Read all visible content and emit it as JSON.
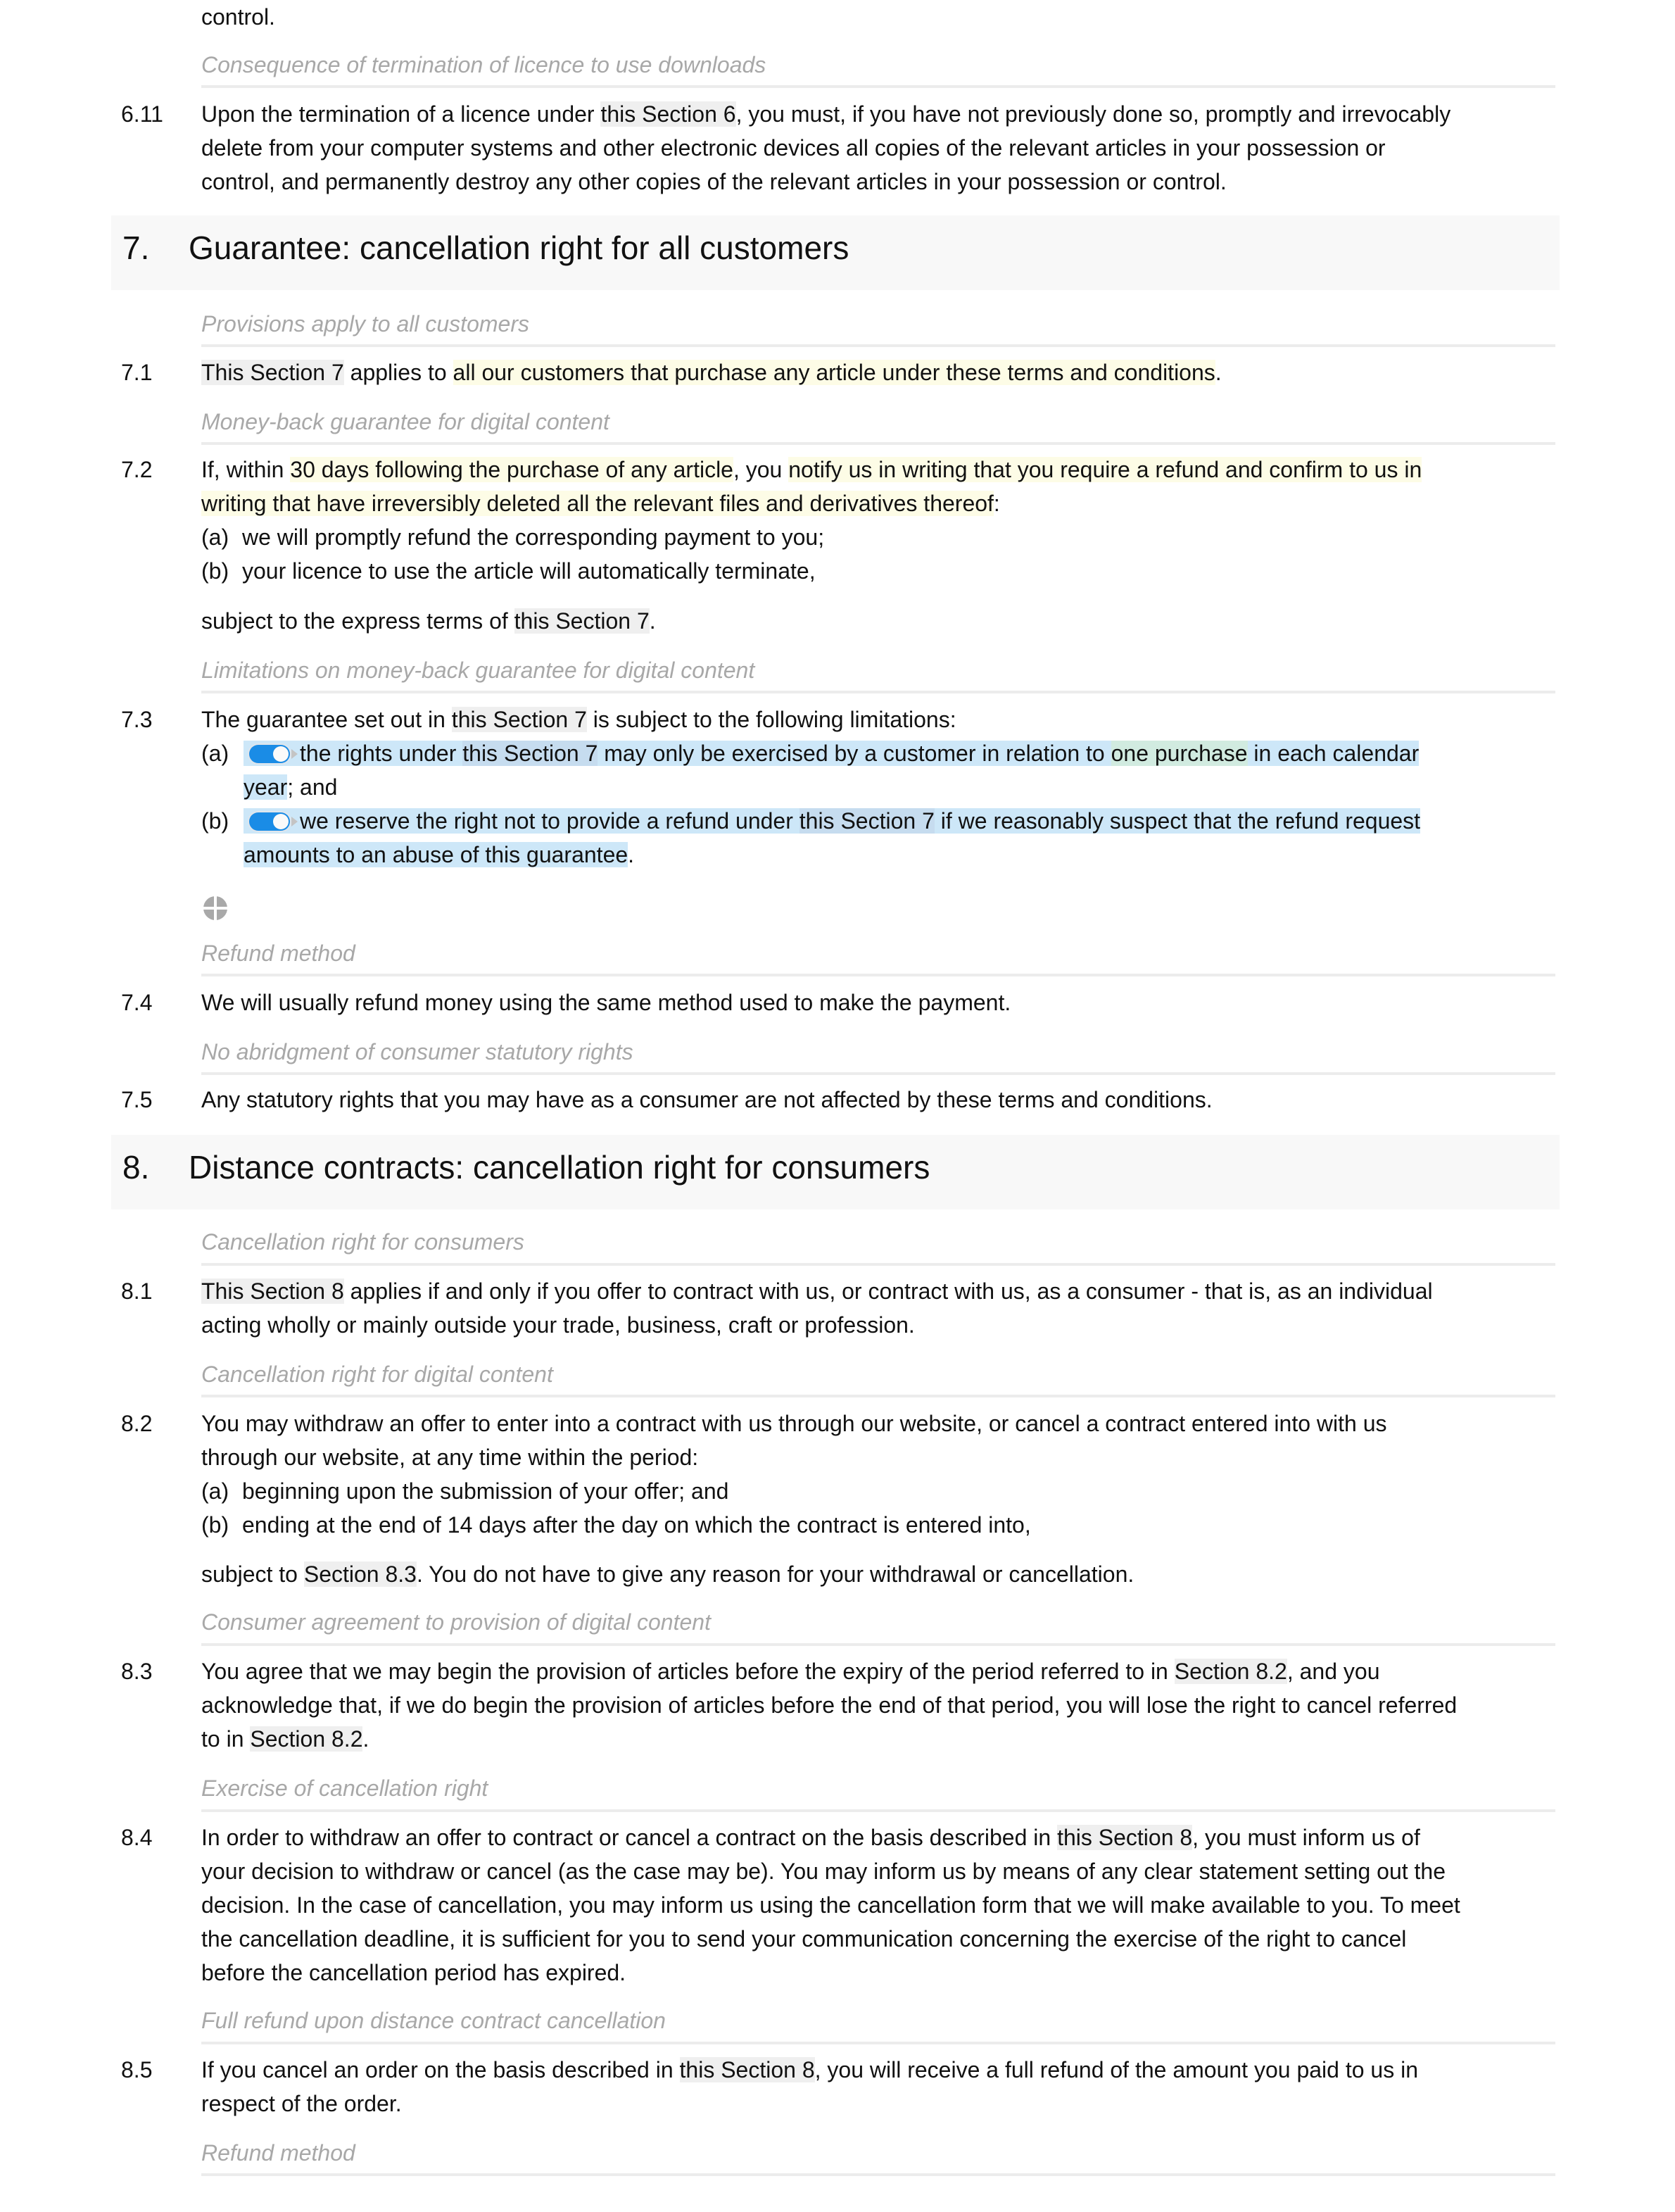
{
  "document": {
    "top_fragment": "control.",
    "caption_6_11": "Consequence of termination of licence to use downloads",
    "clause_6_11": {
      "number": "6.11",
      "line1_pre": "Upon the termination of a licence under ",
      "line1_ref": "this Section 6",
      "line1_post": ", you must, if you have not previously done so, promptly and irrevocably",
      "line2": "delete from your computer systems and other electronic devices all copies of the relevant articles in your possession or",
      "line3": "control, and permanently destroy any other copies of the relevant articles in your possession or control."
    },
    "section_7": {
      "number": "7.",
      "title": "Guarantee: cancellation right for all customers",
      "caption_7_1": "Provisions apply to all customers",
      "clause_7_1": {
        "number": "7.1",
        "ref": "This Section 7",
        "mid": " applies to ",
        "highlight": "all our customers that purchase any article under these terms and conditions",
        "end": "."
      },
      "caption_7_2": "Money-back guarantee for digital content",
      "clause_7_2": {
        "number": "7.2",
        "pre": "If, within ",
        "hl1": "30 days following the purchase of any article",
        "mid": ", you ",
        "hl2a": "notify us in writing that you require a refund and confirm to us in",
        "hl2b": "writing that have irreversibly deleted all the relevant files and derivatives thereof",
        "colon": ":",
        "items": [
          {
            "label": "(a)",
            "text": "we will promptly refund the corresponding payment to you;"
          },
          {
            "label": "(b)",
            "text": "your licence to use the article will automatically terminate,"
          }
        ],
        "tail_pre": "subject to the express terms of ",
        "tail_ref": "this Section 7",
        "tail_end": "."
      },
      "caption_7_3": "Limitations on money-back guarantee for digital content",
      "clause_7_3": {
        "number": "7.3",
        "pre": "The guarantee set out in ",
        "ref": "this Section 7",
        "post": " is subject to the following limitations:",
        "items": [
          {
            "label": "(a)",
            "toggle_on": true,
            "t1": "the rights under ",
            "ref": "this Section 7",
            "t2": " may only be exercised by a customer in relation to ",
            "green": "one purchase",
            "t3": " in each calendar",
            "t4": "year",
            "t5": "; and"
          },
          {
            "label": "(b)",
            "toggle_on": true,
            "t1": "we reserve the right not to provide a refund under ",
            "ref": "this Section 7",
            "t2": " if we reasonably suspect that the refund request",
            "t3": "amounts to an abuse of this guarantee",
            "t4": "."
          }
        ]
      },
      "caption_7_4": "Refund method",
      "clause_7_4": {
        "number": "7.4",
        "text": "We will usually refund money using the same method used to make the payment."
      },
      "caption_7_5": "No abridgment of consumer statutory rights",
      "clause_7_5": {
        "number": "7.5",
        "text": "Any statutory rights that you may have as a consumer are not affected by these terms and conditions."
      }
    },
    "section_8": {
      "number": "8.",
      "title": "Distance contracts: cancellation right for consumers",
      "caption_8_1": "Cancellation right for consumers",
      "clause_8_1": {
        "number": "8.1",
        "ref": "This Section 8",
        "l1": " applies if and only if you offer to contract with us, or contract with us, as a consumer - that is, as an individual",
        "l2": "acting wholly or mainly outside your trade, business, craft or profession."
      },
      "caption_8_2": "Cancellation right for digital content",
      "clause_8_2": {
        "number": "8.2",
        "l1": "You may withdraw an offer to enter into a contract with us through our website, or cancel a contract entered into with us",
        "l2": "through our website, at any time within the period:",
        "items": [
          {
            "label": "(a)",
            "text": "beginning upon the submission of your offer; and"
          },
          {
            "label": "(b)",
            "text": "ending at the end of 14 days after the day on which the contract is entered into,"
          }
        ],
        "tail_pre": "subject to ",
        "tail_ref": "Section 8.3",
        "tail_end": ". You do not have to give any reason for your withdrawal or cancellation."
      },
      "caption_8_3": "Consumer agreement to provision of digital content",
      "clause_8_3": {
        "number": "8.3",
        "l1_pre": "You agree that we may begin the provision of articles before the expiry of the period referred to in ",
        "l1_ref": "Section 8.2",
        "l1_post": ", and you",
        "l2": "acknowledge that, if we do begin the provision of articles before the end of that period, you will lose the right to cancel referred",
        "l3_pre": "to in ",
        "l3_ref": "Section 8.2",
        "l3_post": "."
      },
      "caption_8_4": "Exercise of cancellation right",
      "clause_8_4": {
        "number": "8.4",
        "l1_pre": "In order to withdraw an offer to contract or cancel a contract on the basis described in ",
        "l1_ref": "this Section 8",
        "l1_post": ", you must inform us of",
        "l2": "your decision to withdraw or cancel (as the case may be). You may inform us by means of any clear statement setting out the",
        "l3": "decision. In the case of cancellation, you may inform us using the cancellation form that we will make available to you. To meet",
        "l4": "the cancellation deadline, it is sufficient for you to send your communication concerning the exercise of the right to cancel",
        "l5": "before the cancellation period has expired."
      },
      "caption_8_5": "Full refund upon distance contract cancellation",
      "clause_8_5": {
        "number": "8.5",
        "l1_pre": "If you cancel an order on the basis described in ",
        "l1_ref": "this Section 8",
        "l1_post": ", you will receive a full refund of the amount you paid to us in",
        "l2": "respect of the order."
      },
      "caption_8_6": "Refund method"
    }
  },
  "icons": {
    "toggle": "toggle-switch-icon",
    "gear": "gear-icon"
  },
  "colors": {
    "reference_bg": "#efefef",
    "yellow_highlight": "#fdfce6",
    "blue_highlight": "#cde7f8",
    "green_highlight": "#d1ebe0",
    "toggle_on": "#1a8ce6",
    "caption_text": "#a8a8a8"
  }
}
